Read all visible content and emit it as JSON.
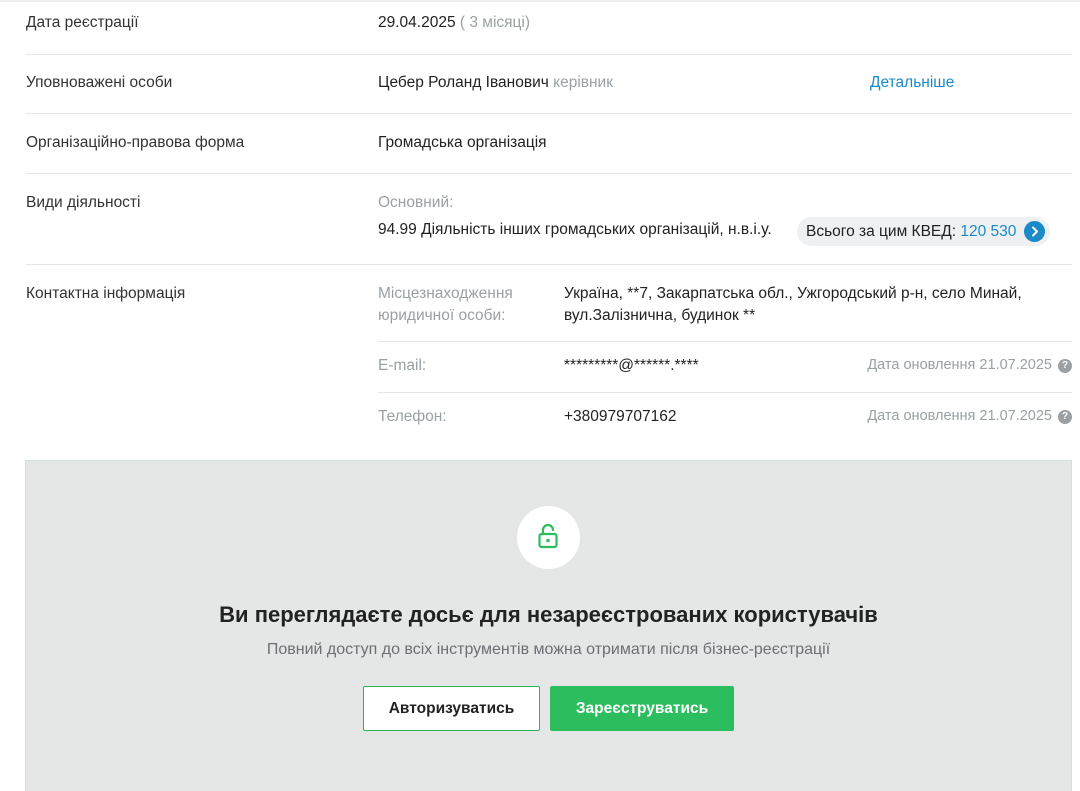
{
  "rows": {
    "registration_date": {
      "label": "Дата реєстрації",
      "value": "29.04.2025",
      "note": "( 3 місяці)"
    },
    "authorized_persons": {
      "label": "Уповноважені особи",
      "name": "Цебер Роланд Іванович",
      "role": "керівник",
      "more_link": "Детальніше"
    },
    "legal_form": {
      "label": "Організаційно-правова форма",
      "value": "Громадська організація"
    },
    "activities": {
      "label": "Види діяльності",
      "primary_label": "Основний:",
      "kved": "94.99 Діяльність інших громадських організацій, н.в.і.у.",
      "total_label": "Всього за цим КВЕД:",
      "total_value": "120 530"
    },
    "contacts": {
      "label": "Контактна інформація",
      "address_label_line1": "Місцезнаходження",
      "address_label_line2": "юридичної особи:",
      "address_line1": "Україна, **7, Закарпатська обл., Ужгородський р-н, село Минай,",
      "address_line2": "вул.Залізнична, будинок **",
      "email_label": "E-mail:",
      "email_value": "*********@******.****",
      "email_updated": "Дата оновлення 21.07.2025",
      "phone_label": "Телефон:",
      "phone_value": "+380979707162",
      "phone_updated": "Дата оновлення 21.07.2025"
    }
  },
  "gate": {
    "title": "Ви переглядаєте досьє для незареєстрованих користувачів",
    "subtitle": "Повний доступ до всіх інструментів можна отримати після бізнес-реєстрації",
    "login_button": "Авторизуватись",
    "register_button": "Зареєструватись",
    "icon": "unlock-icon"
  },
  "colors": {
    "accent_blue": "#1b8ac9",
    "accent_green": "#2bbd5e",
    "muted_text": "#9aa0a3"
  }
}
